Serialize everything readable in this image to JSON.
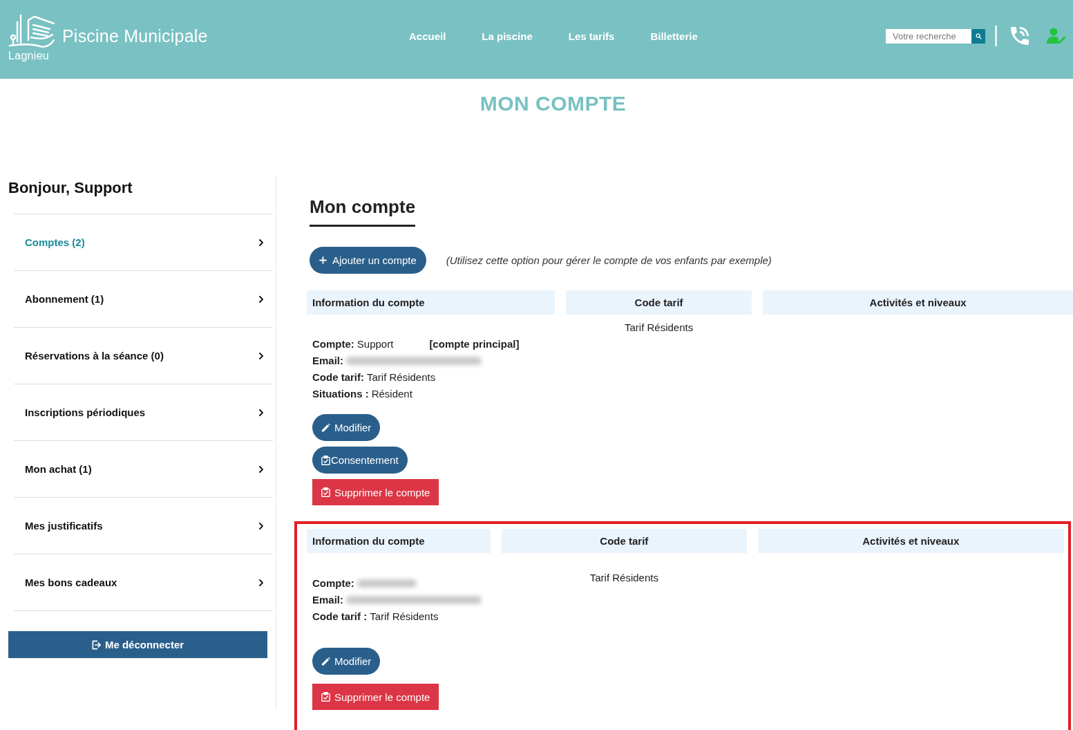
{
  "header": {
    "logo": {
      "name": "Piscine Municipale",
      "town": "Lagnieu"
    },
    "nav": [
      "Accueil",
      "La piscine",
      "Les tarifs",
      "Billetterie"
    ],
    "search": {
      "placeholder": "Votre recherche"
    }
  },
  "page_title": "MON COMPTE",
  "sidebar": {
    "greeting": "Bonjour, Support",
    "items": [
      {
        "label": "Comptes (2)",
        "selected": true
      },
      {
        "label": "Abonnement (1)",
        "selected": false
      },
      {
        "label": "Réservations à la séance (0)",
        "selected": false
      },
      {
        "label": "Inscriptions périodiques",
        "selected": false
      },
      {
        "label": "Mon achat (1)",
        "selected": false
      },
      {
        "label": "Mes justificatifs",
        "selected": false
      },
      {
        "label": "Mes bons cadeaux",
        "selected": false
      }
    ],
    "logout": "Me déconnecter"
  },
  "main": {
    "heading": "Mon compte",
    "add_button": "Ajouter un compte",
    "add_hint": "(Utilisez cette option pour gérer le compte de vos enfants par exemple)",
    "accounts": [
      {
        "kind": "principal",
        "highlighted": false,
        "columns": [
          "Information du compte",
          "Code tarif",
          "Activités et niveaux"
        ],
        "tarif": "Tarif Résidents",
        "fields": [
          {
            "label": "Compte:",
            "kind": "text",
            "value": "Support",
            "tag": "[compte principal]"
          },
          {
            "label": "Email:",
            "kind": "blur_long"
          },
          {
            "label": "Code tarif:",
            "kind": "text",
            "value": "Tarif Résidents"
          },
          {
            "label": "Situations :",
            "kind": "text",
            "value": "Résident"
          }
        ],
        "buttons": [
          {
            "kind": "edit",
            "label": "Modifier"
          },
          {
            "kind": "consent",
            "label": "Consentement"
          },
          {
            "kind": "delete",
            "label": "Supprimer le compte"
          }
        ]
      },
      {
        "kind": "secondary",
        "highlighted": true,
        "columns": [
          "Information du compte",
          "Code tarif",
          "Activités et niveaux"
        ],
        "tarif": "Tarif Résidents",
        "fields": [
          {
            "label": "Compte:",
            "kind": "blur_short"
          },
          {
            "label": "Email:",
            "kind": "blur_long"
          },
          {
            "label": "Code tarif :",
            "kind": "text",
            "value": "Tarif Résidents"
          }
        ],
        "buttons": [
          {
            "kind": "edit",
            "label": "Modifier"
          },
          {
            "kind": "delete",
            "label": "Supprimer le compte"
          }
        ]
      }
    ]
  }
}
